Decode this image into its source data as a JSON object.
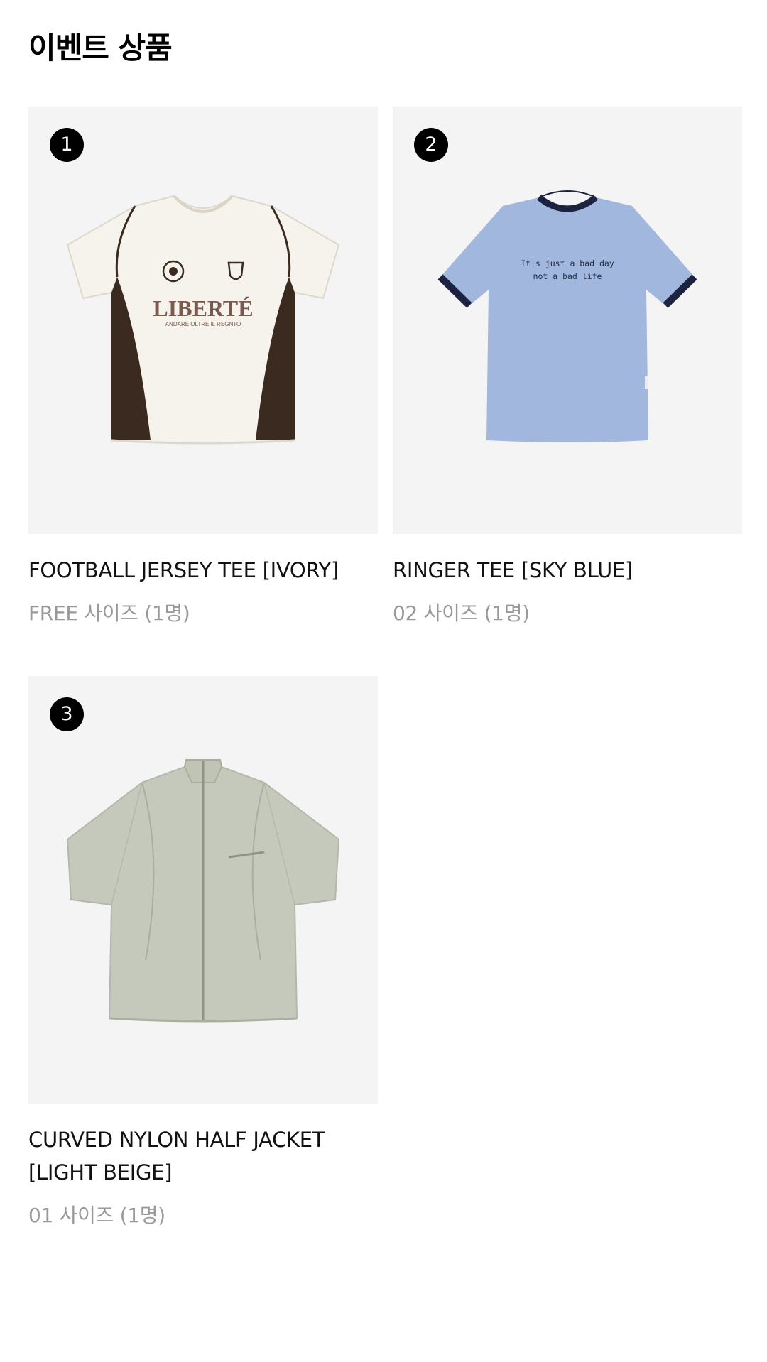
{
  "page": {
    "title": "이벤트 상품"
  },
  "products": [
    {
      "rank": "1",
      "name": "FOOTBALL JERSEY TEE [IVORY]",
      "meta": "FREE 사이즈 (1명)",
      "image": {
        "icon": "football-jersey-tee-image",
        "print_main": "LIBERTÉ",
        "print_sub": "ANDARE OLTRE IL REGNTO",
        "colors": {
          "body": "#f5f3ec",
          "panel": "#3b2a20",
          "print": "#7a5a4e"
        }
      }
    },
    {
      "rank": "2",
      "name": "RINGER TEE [SKY BLUE]",
      "meta": "02 사이즈 (1명)",
      "image": {
        "icon": "ringer-tee-image",
        "print_line1": "It's just a bad day",
        "print_line2": "not a bad life",
        "colors": {
          "body": "#a2b7dd",
          "trim": "#1c2340",
          "print": "#1e2a44"
        }
      }
    },
    {
      "rank": "3",
      "name": "CURVED NYLON HALF JACKET [LIGHT BEIGE]",
      "meta": "01 사이즈 (1명)",
      "image": {
        "icon": "nylon-half-jacket-image",
        "colors": {
          "body": "#c4c9bb",
          "seam": "#a9ae9f"
        }
      }
    }
  ],
  "colors": {
    "card_background": "#f4f4f4",
    "badge": "#000000",
    "meta_text": "#999999"
  }
}
